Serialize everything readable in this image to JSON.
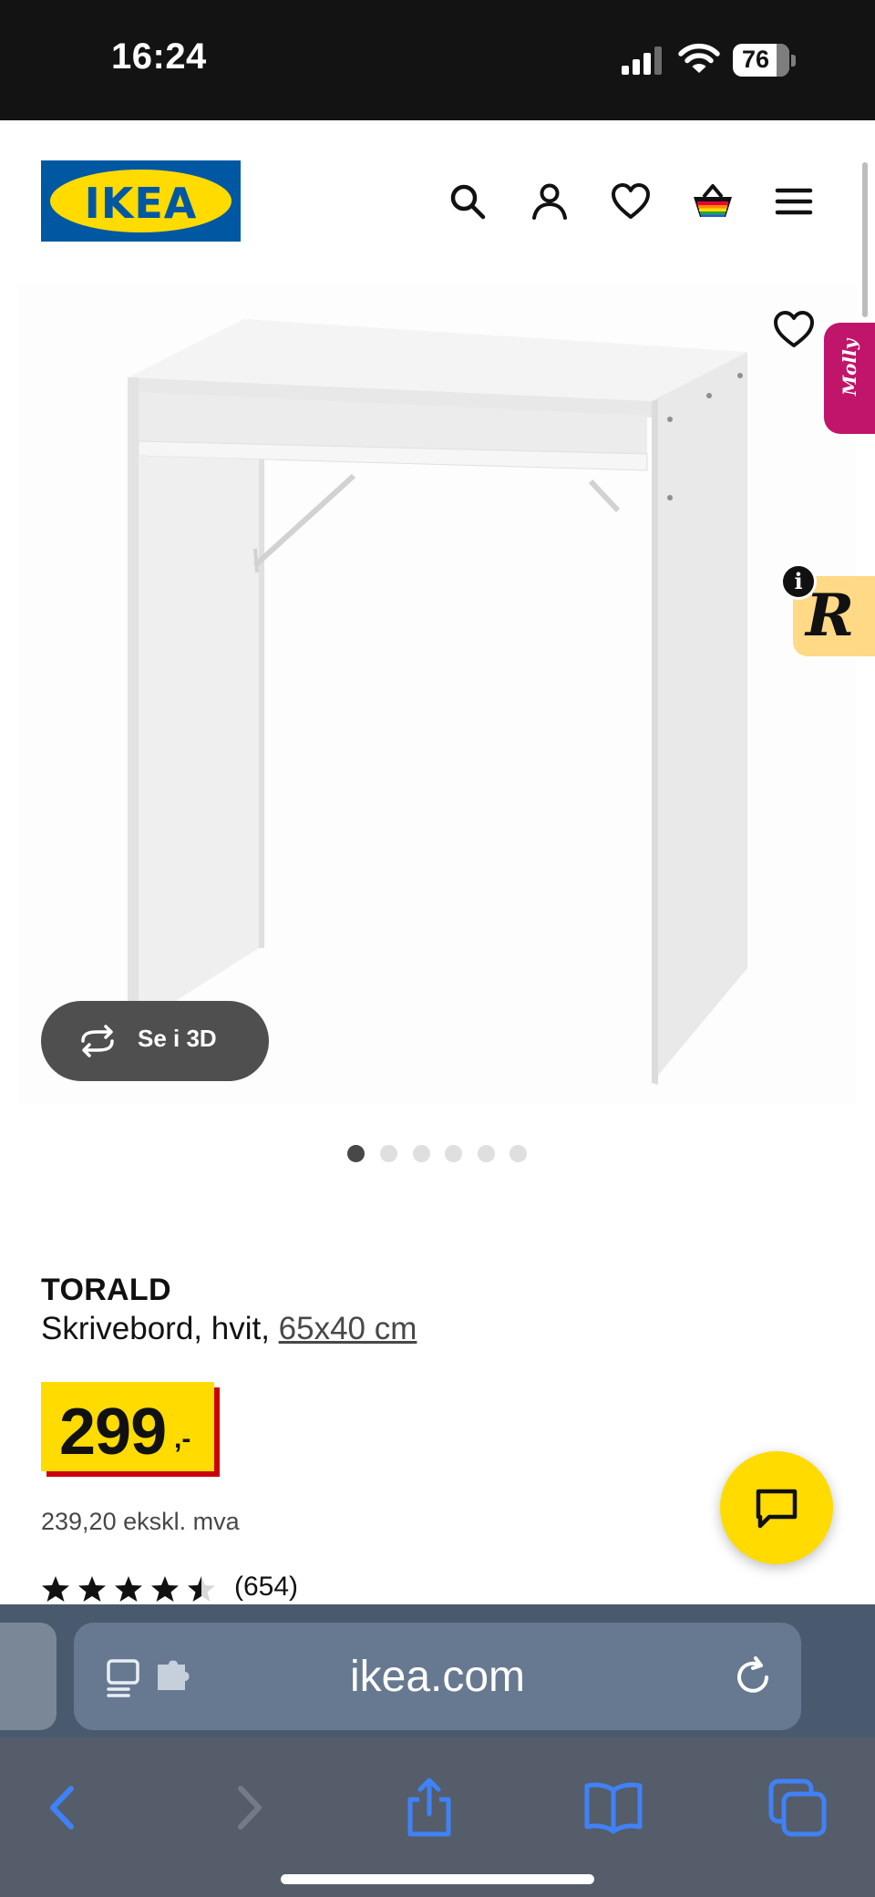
{
  "status_bar": {
    "time": "16:24",
    "battery": "76"
  },
  "header": {
    "logo_text": "IKEA",
    "icons": [
      "search-icon",
      "account-icon",
      "heart-icon",
      "basket-icon",
      "menu-icon"
    ]
  },
  "gallery": {
    "view_3d_label": "Se i 3D",
    "molly_label": "Molly",
    "r_label": "R",
    "info_label": "i",
    "dots_total": 6,
    "dots_active_index": 0
  },
  "product": {
    "name": "TORALD",
    "description": "Skrivebord, hvit, ",
    "size": "65x40 cm",
    "price": "299",
    "price_suffix": ",-",
    "price_ex_vat": "239,20 ekskl. mva",
    "rating": 4.5,
    "rating_max": 5,
    "review_count": "(654)"
  },
  "browser": {
    "url": "ikea.com"
  },
  "colors": {
    "ikea_blue": "#0058a3",
    "ikea_yellow": "#ffdb00",
    "price_red": "#cc0008",
    "safari_blue": "#3f82f7"
  }
}
